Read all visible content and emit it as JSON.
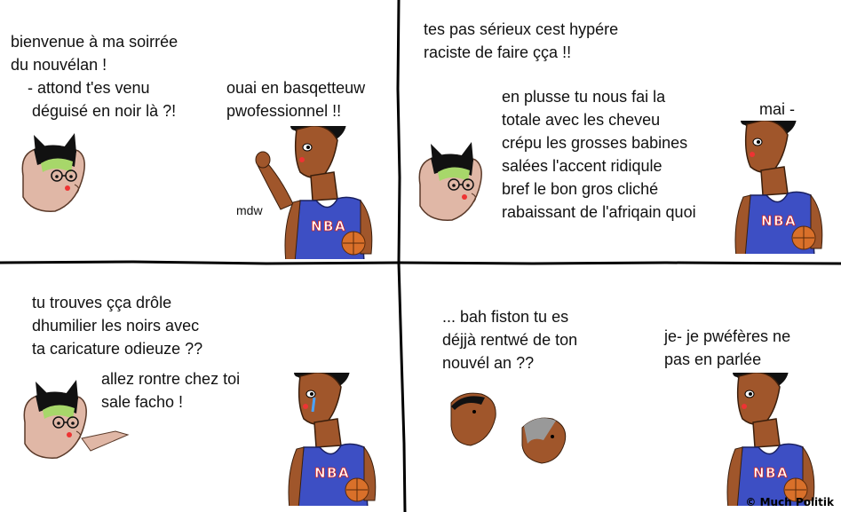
{
  "panel1": {
    "cat_line1": "bienvenue à ma soirrée",
    "cat_line2": "du nouvélan !",
    "cat_line3": " - attond t'es venu",
    "cat_line4": "déguisé en noir là ?!",
    "guy_line1": "ouai en basqetteuw",
    "guy_line2": "pwofessionnel !!",
    "aside": "mdw"
  },
  "panel2": {
    "line1": "tes pas sérieux cest hypére",
    "line2": "raciste de faire çça !!",
    "line3": "en plusse tu nous fai la",
    "line4": "totale avec les cheveu",
    "line5": "crépu les grosses babines",
    "line6": "salées l'accent ridiqule",
    "line7": "bref le bon gros cliché",
    "line8": "rabaissant de l'afriqain quoi",
    "guy_line": "mai -"
  },
  "panel3": {
    "line1": "tu trouves çça drôle",
    "line2": "dhumilier les noirs avec",
    "line3": "ta caricature odieuze ??",
    "line4": "allez rontre chez toi",
    "line5": "sale facho !"
  },
  "panel4": {
    "line1": "... bah fiston tu es",
    "line2": "déjjà rentwé de ton",
    "line3": "nouvél an ??",
    "guy_line1": "je- je pwéfères ne",
    "guy_line2": "pas en parlée"
  },
  "shirt_text": "NBA",
  "credit": "© Much Politik",
  "colors": {
    "skin": "#a0562b",
    "hair": "#111111",
    "jersey": "#3d4fc4",
    "cat_skin": "#e0b7a6",
    "cat_hair": "#a7d76a",
    "ball": "#d9702a"
  }
}
